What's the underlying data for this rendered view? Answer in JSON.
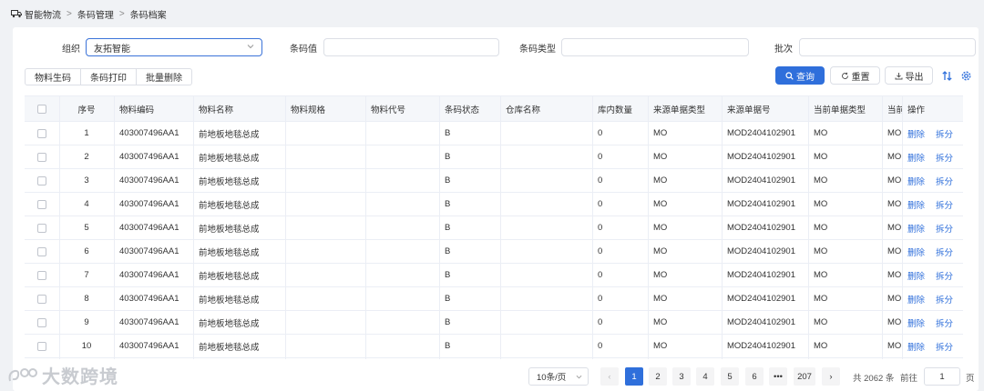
{
  "breadcrumb": [
    "智能物流",
    "条码管理",
    "条码档案"
  ],
  "filters": {
    "org_label": "组织",
    "org_value": "友拓智能",
    "barcode_value_label": "条码值",
    "barcode_type_label": "条码类型",
    "batch_label": "批次"
  },
  "toolbar": {
    "gen_material_code": "物料生码",
    "print_barcode": "条码打印",
    "batch_delete": "批量删除",
    "query": "查询",
    "reset": "重置",
    "export": "导出"
  },
  "table": {
    "headers": [
      "序号",
      "物料编码",
      "物料名称",
      "物料规格",
      "物料代号",
      "条码状态",
      "仓库名称",
      "库内数量",
      "来源单据类型",
      "来源单据号",
      "当前单据类型",
      "当前",
      "操作"
    ],
    "actions": [
      "删除",
      "拆分"
    ],
    "rows": [
      {
        "idx": "1",
        "code": "403007496AA1",
        "name": "前地板地毯总成",
        "status": "B",
        "qty": "0",
        "src_type": "MO",
        "src_no": "MOD2404102901",
        "cur_type": "MO",
        "cur": "MO"
      },
      {
        "idx": "2",
        "code": "403007496AA1",
        "name": "前地板地毯总成",
        "status": "B",
        "qty": "0",
        "src_type": "MO",
        "src_no": "MOD2404102901",
        "cur_type": "MO",
        "cur": "MO"
      },
      {
        "idx": "3",
        "code": "403007496AA1",
        "name": "前地板地毯总成",
        "status": "B",
        "qty": "0",
        "src_type": "MO",
        "src_no": "MOD2404102901",
        "cur_type": "MO",
        "cur": "MO"
      },
      {
        "idx": "4",
        "code": "403007496AA1",
        "name": "前地板地毯总成",
        "status": "B",
        "qty": "0",
        "src_type": "MO",
        "src_no": "MOD2404102901",
        "cur_type": "MO",
        "cur": "MO"
      },
      {
        "idx": "5",
        "code": "403007496AA1",
        "name": "前地板地毯总成",
        "status": "B",
        "qty": "0",
        "src_type": "MO",
        "src_no": "MOD2404102901",
        "cur_type": "MO",
        "cur": "MO"
      },
      {
        "idx": "6",
        "code": "403007496AA1",
        "name": "前地板地毯总成",
        "status": "B",
        "qty": "0",
        "src_type": "MO",
        "src_no": "MOD2404102901",
        "cur_type": "MO",
        "cur": "MO"
      },
      {
        "idx": "7",
        "code": "403007496AA1",
        "name": "前地板地毯总成",
        "status": "B",
        "qty": "0",
        "src_type": "MO",
        "src_no": "MOD2404102901",
        "cur_type": "MO",
        "cur": "MO"
      },
      {
        "idx": "8",
        "code": "403007496AA1",
        "name": "前地板地毯总成",
        "status": "B",
        "qty": "0",
        "src_type": "MO",
        "src_no": "MOD2404102901",
        "cur_type": "MO",
        "cur": "MO"
      },
      {
        "idx": "9",
        "code": "403007496AA1",
        "name": "前地板地毯总成",
        "status": "B",
        "qty": "0",
        "src_type": "MO",
        "src_no": "MOD2404102901",
        "cur_type": "MO",
        "cur": "MO"
      },
      {
        "idx": "10",
        "code": "403007496AA1",
        "name": "前地板地毯总成",
        "status": "B",
        "qty": "0",
        "src_type": "MO",
        "src_no": "MOD2404102901",
        "cur_type": "MO",
        "cur": "MO"
      }
    ]
  },
  "pagination": {
    "page_size": "10条/页",
    "pages": [
      "1",
      "2",
      "3",
      "4",
      "5",
      "6",
      "•••",
      "207"
    ],
    "total": "共 2062 条",
    "goto_label": "前往",
    "goto_value": "1",
    "page_unit": "页"
  },
  "watermark": "大数跨境",
  "colors": {
    "primary": "#2f6fdb",
    "border": "#dcdfe6",
    "header_bg": "#f5f7fa"
  }
}
